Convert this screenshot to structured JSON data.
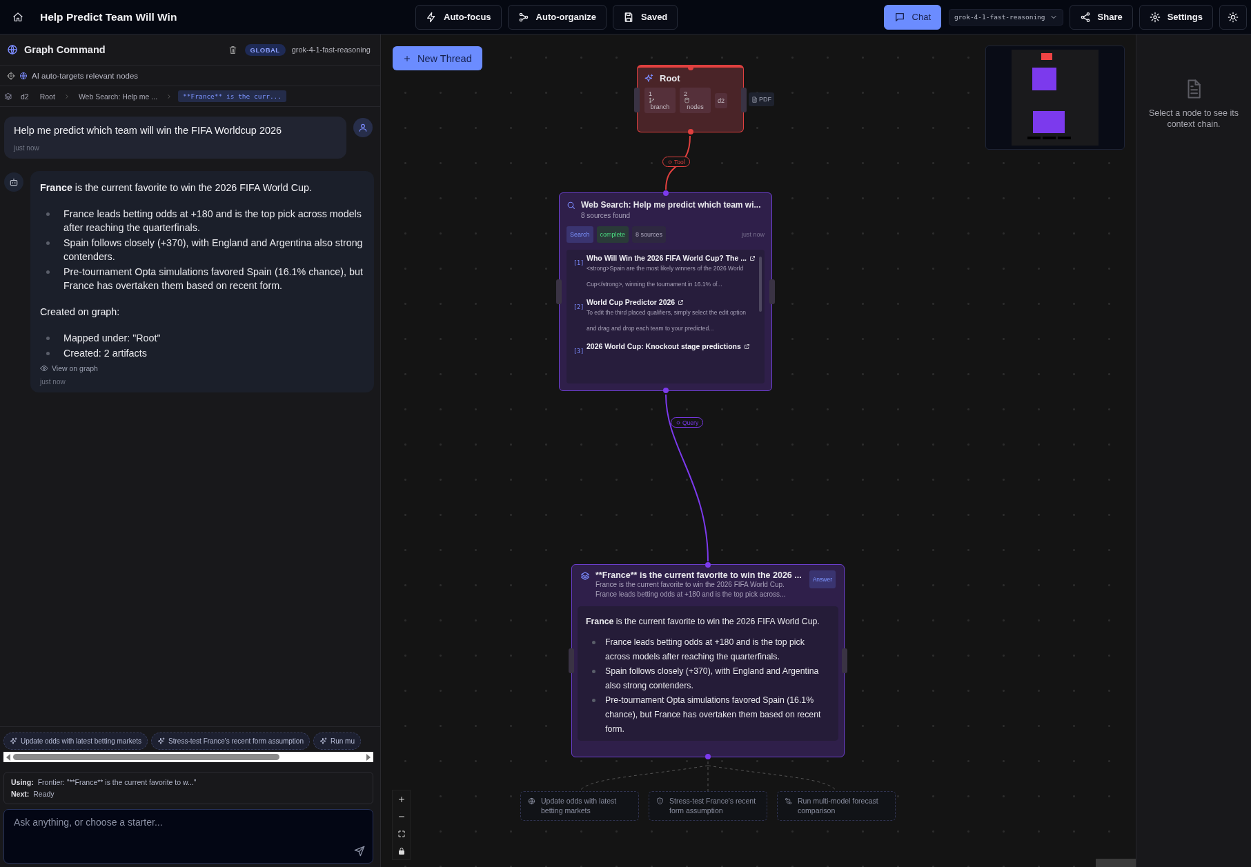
{
  "header": {
    "title": "Help Predict Team Will Win",
    "tools": [
      {
        "label": "Auto-focus"
      },
      {
        "label": "Auto-organize"
      },
      {
        "label": "Saved"
      }
    ],
    "chat_button": {
      "label": "Chat",
      "selected": true
    },
    "model_select": {
      "value": "grok-4-1-fast-reasoning"
    },
    "share_button": {
      "label": "Share"
    },
    "settings_button": {
      "label": "Settings"
    }
  },
  "sidebar": {
    "title": "Graph Command",
    "scope_badge": "GLOBAL",
    "model": "grok-4-1-fast-reasoning",
    "targeting_note": "AI auto-targets relevant nodes",
    "breadcrumb": [
      {
        "label": "d2",
        "selected": false
      },
      {
        "label": "Root",
        "selected": false
      },
      {
        "label": "Web Search: Help me ...",
        "selected": false
      },
      {
        "label": "**France** is the curr...",
        "selected": true
      }
    ],
    "messages": [
      {
        "kind": "user",
        "text": "Help me predict which team will win the FIFA Worldcup 2026",
        "time": "just now"
      },
      {
        "kind": "assistant",
        "blocks": [
          {
            "kind": "paragraph",
            "text": "**France** is the current favorite to win the 2026 FIFA World Cup."
          },
          {
            "kind": "list",
            "items": [
              "France leads betting odds at +180 and is the top pick across models after reaching the quarterfinals.",
              "Spain follows closely (+370), with England and Argentina also strong contenders.",
              "Pre-tournament Opta simulations favored Spain (16.1% chance), but France has overtaken them based on recent form."
            ]
          },
          {
            "kind": "paragraph",
            "text": "Created on graph:"
          },
          {
            "kind": "list",
            "items": [
              "Mapped under: \"Root\"",
              "Created: 2 artifacts"
            ]
          }
        ],
        "link": "View on graph",
        "time": "just now"
      }
    ],
    "starters": [
      "Update odds with latest betting markets",
      "Stress-test France's recent form assumption",
      "Run mu"
    ],
    "context": [
      {
        "label": "Using:",
        "value": "Frontier: \"**France** is the current favorite to w...\""
      },
      {
        "label": "Next:",
        "value": "Ready"
      }
    ],
    "input": {
      "placeholder": "Ask anything, or choose a starter..."
    }
  },
  "canvas": {
    "new_thread": "New Thread",
    "root_node": {
      "title": "Root",
      "stats": [
        {
          "value": "1",
          "label": "branch"
        },
        {
          "value": "2",
          "label": "nodes"
        }
      ],
      "depth": "d2",
      "export": "PDF"
    },
    "edges": [
      {
        "label": "Tool",
        "color": "#e0403f"
      },
      {
        "label": "Query",
        "color": "#7c3aed"
      }
    ],
    "search_node": {
      "title": "Web Search: Help me predict which team wi...",
      "subtitle": "8 sources found",
      "tags": [
        {
          "kind": "type",
          "label": "Search"
        },
        {
          "kind": "status",
          "label": "complete"
        },
        {
          "kind": "count",
          "label": "8 sources"
        }
      ],
      "time": "just now",
      "results": [
        {
          "number": "[1]",
          "title": "Who Will Win the 2026 FIFA World Cup? The ...",
          "snippet": "<strong>Spain are the most likely winners of the 2026 World Cup</strong>, winning the tournament in 16.1% of..."
        },
        {
          "number": "[2]",
          "title": "World Cup Predictor 2026",
          "snippet": "To edit the third placed qualifiers, simply select the edit option and drag and drop each team to your predicted..."
        },
        {
          "number": "[3]",
          "title": "2026 World Cup: Knockout stage predictions"
        }
      ]
    },
    "answer_node": {
      "title": "**France** is the current favorite to win the 2026 ...",
      "summary": [
        "France is the current favorite to win the 2026 FIFA World Cup.",
        "France leads betting odds at +180 and is the top pick across..."
      ],
      "badge": "Answer",
      "blocks": [
        {
          "kind": "paragraph",
          "text": "**France** is the current favorite to win the 2026 FIFA World Cup."
        },
        {
          "kind": "list",
          "items": [
            "France leads betting odds at +180 and is the top pick across models after reaching the quarterfinals.",
            "Spain follows closely (+370), with England and Argentina also strong contenders.",
            "Pre-tournament Opta simulations favored Spain (16.1% chance), but France has overtaken them based on recent form."
          ]
        }
      ]
    },
    "suggestions": [
      "Update odds with latest betting markets",
      "Stress-test France's recent form assumption",
      "Run multi-model forecast comparison"
    ]
  },
  "context_panel": {
    "empty_text": "Select a node to see its context chain."
  }
}
